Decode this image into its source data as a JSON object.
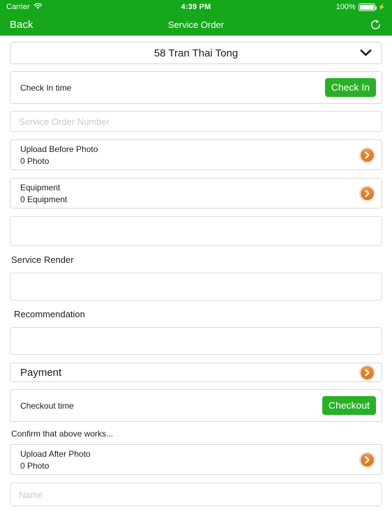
{
  "status_bar": {
    "carrier": "Carrier",
    "wifi_icon": "wifi-icon",
    "time": "4:39 PM",
    "battery_percent": "100%",
    "battery_icon": "battery-icon",
    "charging_icon": "lightning-bolt-icon"
  },
  "nav_bar": {
    "back_label": "Back",
    "title": "Service Order",
    "refresh_icon": "refresh-icon",
    "background_color": "#16a81a"
  },
  "form": {
    "site_dropdown": {
      "value": "58 Tran Thai Tong",
      "chevron_icon": "chevron-down-icon"
    },
    "check_in": {
      "label": "Check In time",
      "button_label": "Check In",
      "button_color": "#2ab027"
    },
    "service_order_number": {
      "value": "",
      "placeholder": "Service Order Number"
    },
    "upload_before_photo": {
      "title": "Upload Before Photo",
      "subtitle": "0 Photo",
      "arrow_icon": "chevron-right-circle-icon"
    },
    "equipment": {
      "title": "Equipment",
      "subtitle": "0 Equipment",
      "arrow_icon": "chevron-right-circle-icon"
    },
    "notes_box": {
      "value": "",
      "placeholder": ""
    },
    "service_render": {
      "label": "Service Render",
      "value": "",
      "placeholder": ""
    },
    "recommendation": {
      "label": "Recommendation",
      "value": "",
      "placeholder": ""
    },
    "payment": {
      "label": "Payment",
      "arrow_icon": "chevron-right-circle-icon"
    },
    "checkout": {
      "label": "Checkout time",
      "button_label": "Checkout",
      "button_color": "#2ab027"
    },
    "confirm_note": "Confirm that above works...",
    "upload_after_photo": {
      "title": "Upload After Photo",
      "subtitle": "0 Photo",
      "arrow_icon": "chevron-right-circle-icon"
    },
    "name_field": {
      "value": "",
      "placeholder": "Name"
    }
  },
  "colors": {
    "accent_green": "#16a81a",
    "button_green": "#2ab027",
    "accent_orange": "#e3802a",
    "border": "#d8d8d8",
    "placeholder": "#c9c9c9"
  }
}
